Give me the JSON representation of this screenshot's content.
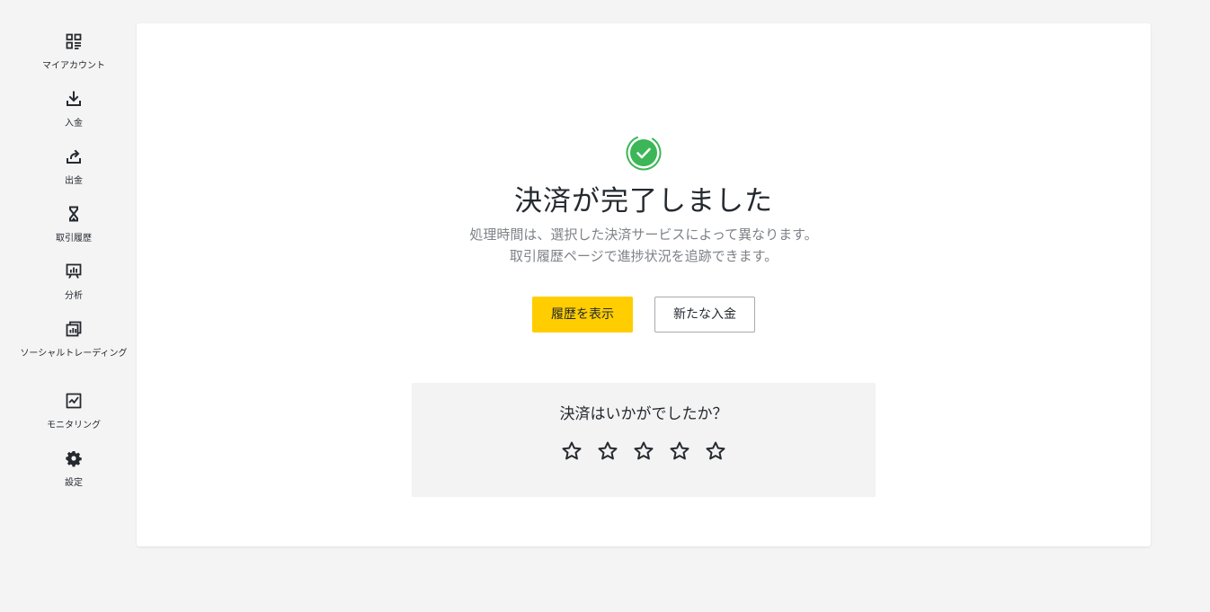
{
  "sidebar": {
    "items": [
      {
        "label": "マイアカウント",
        "icon": "dashboard-icon"
      },
      {
        "label": "入金",
        "icon": "download-icon"
      },
      {
        "label": "出金",
        "icon": "upload-share-icon"
      },
      {
        "label": "取引履歴",
        "icon": "hourglass-icon"
      },
      {
        "label": "分析",
        "icon": "presentation-chart-icon"
      },
      {
        "label": "ソーシャルトレーディング",
        "icon": "copy-trading-icon"
      },
      {
        "label": "モニタリング",
        "icon": "monitoring-chart-icon"
      },
      {
        "label": "設定",
        "icon": "gear-icon"
      }
    ]
  },
  "main": {
    "success_icon": "check-circle-icon",
    "title": "決済が完了しました",
    "subtitle_line1": "処理時間は、選択した決済サービスによって異なります。",
    "subtitle_line2": "取引履歴ページで進捗状況を追跡できます。",
    "view_history_label": "履歴を表示",
    "new_deposit_label": "新たな入金"
  },
  "rating": {
    "question": "決済はいかがでしたか？",
    "star_count": 5,
    "selected": 0
  },
  "colors": {
    "accent_yellow": "#ffcd00",
    "success_green": "#3cb656",
    "text_dark": "#252a30",
    "text_muted": "#7e8287"
  }
}
